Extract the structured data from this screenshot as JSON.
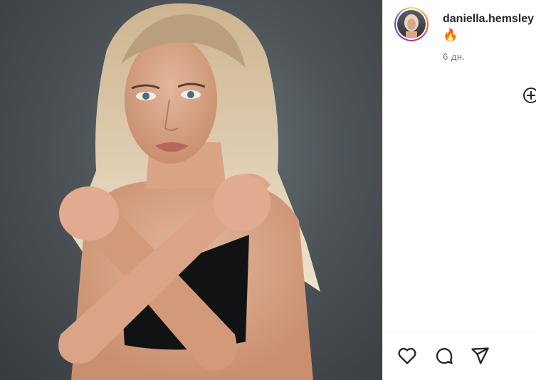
{
  "post": {
    "username": "daniella.hemsley",
    "caption_emoji": "🔥",
    "time_ago": "6 дн."
  },
  "icons": {
    "add": "add-circle-icon",
    "like": "heart-icon",
    "comment": "comment-icon",
    "share": "share-icon"
  },
  "colors": {
    "photo_background": "#4d5459",
    "username_text": "#262626",
    "time_text": "#737373",
    "story_ring": [
      "#feda75",
      "#fa7e1e",
      "#d62976",
      "#962fbf",
      "#4f5bd5"
    ]
  }
}
